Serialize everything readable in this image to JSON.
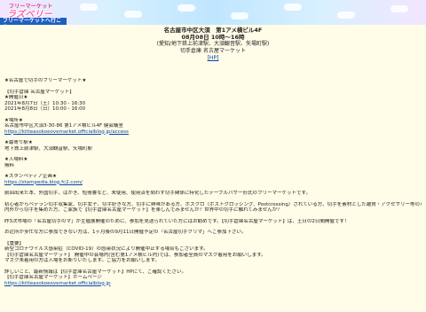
{
  "logo": {
    "small": "フリーマーケット",
    "big": "ラズベリー"
  },
  "nav": {
    "strip": "フリーマーケットへ行こう！"
  },
  "event": {
    "title": "名古屋市中区大須　第1アメ横ビル4F",
    "datetime": "08月08日 10時〜16時",
    "access": "(愛知/地下鉄上前津駅、大須観音駅、矢場町駅)",
    "organizer": "切手倉庫 名古屋マーケット",
    "hp": "[HP]"
  },
  "body": {
    "l1": "★名古屋で切手のフリーマーケット★",
    "l2": "【切手倉庫 名古屋マーケット】",
    "l3": "★開催日★",
    "l4": "2021年8月7日（土）10:30 - 16:30",
    "l5": "2021年8月8日（日）10:00 - 16:00",
    "l6": "★場所★",
    "l7": "名古屋市中区大須3-30-86 第1アメ横ビル4F 健会議室",
    "l8": "https://kitteasokoeovemarket.officialblog.jp/access",
    "l9": "★最寄り駅★",
    "l10": "地下鉄上前津駅、大須観音駅、矢場町駅",
    "l11": "★入場料★",
    "l12": "無料",
    "l13": "★スタンペディア企画★",
    "l14": "https://stampedia.blog.fc2.com/",
    "p1": "前回出来た本、外国切手、はがき、短冊書など、未使用、使用済を問わず切手関係に特化したテーブルバザー形式のフリーマーケットです。",
    "p2": "初心者からベテラン切手収集家、切手女子、切手好きな方、切手に興味がある方、ポスクロ（ポストクロッシング、Postcrossing）されている方、切手を素材とした雑貨・アクセサリー等のハンドメイドクリエイターの方、雲",
    "p2b": "内外から切手を集めた方、ご家族で【切手倉庫名古屋マーケット】を楽しんでみませんか？世界中の切手に触れてみませんか？",
    "p3": "昨3次市場の「名古屋切手のマ」が主催展開催のために、参加を見送られていた方にはお勧めです。【切手倉庫名古屋マーケット】は、土日の2日間開催です！",
    "p4": "お近所が多忙な方に参加できない方は、1ヶ月後の9月11日開催予定の「名古屋切手クリマ」へご参加下さい。",
    "p5": "【重要】",
    "p6": "新型コロナウイルス感染症（COVID-19）の感染状況により開催中止する場合もございます。",
    "p7": "【切手倉庫名古屋マーケット】 開催中の会場内(含む第1アメ横ビル内)では、参加者全員のマスク着用をお願いします。",
    "p8": "マスク未着用の方は入場をお断りいたします。ご協力をお願いします。",
    "p9": "詳しいこと、最新情報は【切手倉庫名古屋マーケット】HPにて、ご確認ください。",
    "p10": "【切手倉庫名古屋マーケット】ホームページ",
    "p11": "https://kitteasokoeovemarket.officialblog.jp"
  }
}
